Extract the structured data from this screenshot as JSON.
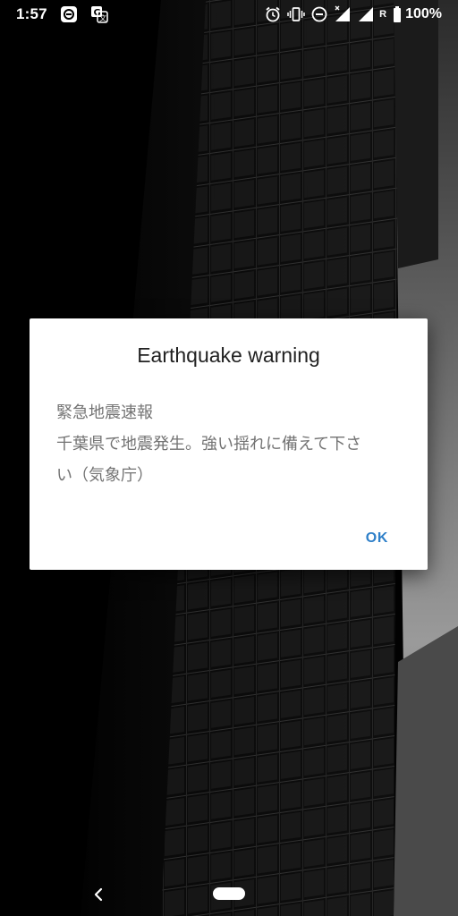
{
  "status_bar": {
    "time": "1:57",
    "left_icons": [
      "photos-icon",
      "translate-icon"
    ],
    "right_icons": [
      "alarm-icon",
      "vibrate-icon",
      "do-not-disturb-icon",
      "signal-no-data-icon",
      "signal-icon"
    ],
    "roaming": "R",
    "battery": "100%"
  },
  "dialog": {
    "title": "Earthquake warning",
    "message_lines": [
      "緊急地震速報",
      "千葉県で地震発生。強い揺れに備えて下さ",
      "い（気象庁）"
    ],
    "ok_label": "OK",
    "ok_color": "#2f80c9"
  },
  "nav_bar": {
    "icons": [
      "back-icon",
      "home-pill-icon"
    ]
  }
}
